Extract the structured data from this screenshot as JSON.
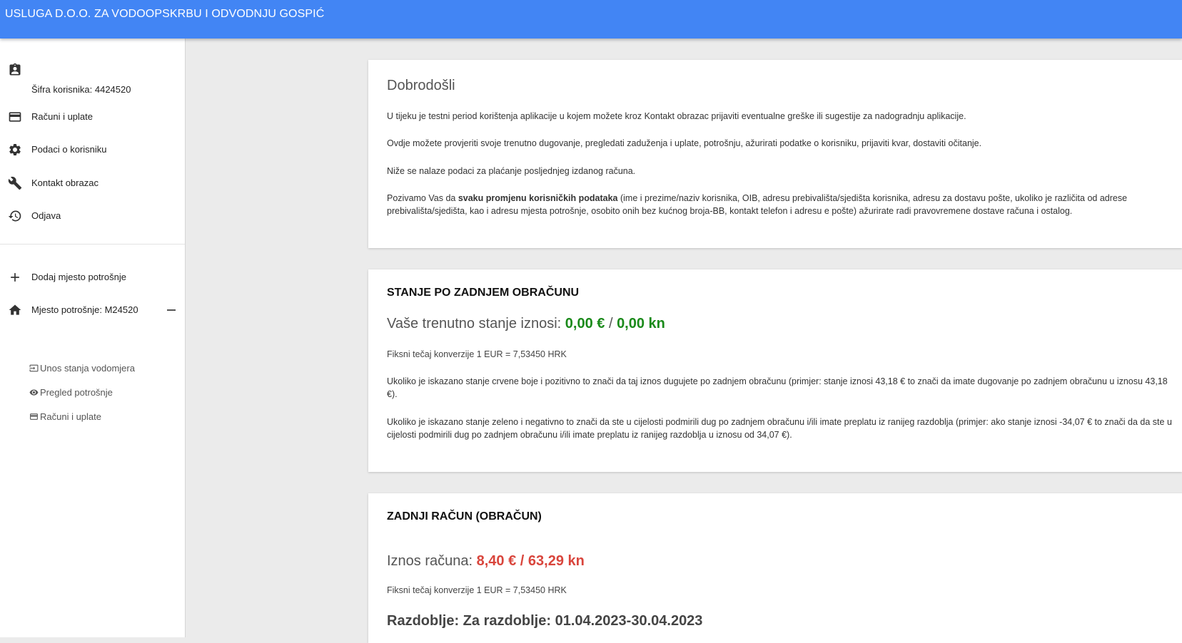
{
  "header": {
    "title": "USLUGA D.O.O. ZA VODOOPSKRBU I ODVODNJU GOSPIĆ"
  },
  "sidebar": {
    "user_label": "Šifra korisnika: 4424520",
    "items": [
      {
        "label": "Računi i uplate",
        "icon": "credit-card-icon"
      },
      {
        "label": "Podaci o korisniku",
        "icon": "gear-icon"
      },
      {
        "label": "Kontakt obrazac",
        "icon": "wrench-icon"
      },
      {
        "label": "Odjava",
        "icon": "history-icon"
      }
    ],
    "add_place_label": "Dodaj mjesto potrošnje",
    "place_label": "Mjesto potrošnje: M24520",
    "sub_items": [
      {
        "label": "Unos stanja vodomjera",
        "icon": "input-icon"
      },
      {
        "label": "Pregled potrošnje",
        "icon": "eye-icon"
      },
      {
        "label": "Računi i uplate",
        "icon": "credit-card-icon"
      }
    ]
  },
  "welcome": {
    "title": "Dobrodošli",
    "p1": "U tijeku je testni period korištenja aplikacije u kojem možete kroz Kontakt obrazac prijaviti eventualne greške ili sugestije za nadogradnju aplikacije.",
    "p2": "Ovdje možete provjeriti svoje trenutno dugovanje, pregledati zaduženja i uplate, potrošnju, ažurirati podatke o korisniku, prijaviti kvar, dostaviti očitanje.",
    "p3": "Niže se nalaze podaci za plaćanje posljednjeg izdanog računa.",
    "p4_prefix": "Pozivamo Vas da ",
    "p4_bold": "svaku promjenu korisničkih podataka",
    "p4_rest": " (ime i prezime/naziv korisnika, OIB, adresu prebivališta/sjedišta korisnika, adresu za dostavu pošte, ukoliko je različita od adrese prebivališta/sjedišta, kao i adresu mjesta potrošnje, osobito onih bez kućnog broja-BB, kontakt telefon i adresu e pošte) ažurirate radi pravovremene dostave računa i ostalog."
  },
  "balance": {
    "title": "STANJE PO ZADNJEM OBRAČUNU",
    "label": "Vaše trenutno stanje iznosi: ",
    "eur": "0,00 €",
    "sep": " / ",
    "kn": "0,00 kn",
    "rate": "Fiksni tečaj konverzije 1 EUR = 7,53450 HRK",
    "p_red": "Ukoliko je iskazano stanje crvene boje i pozitivno to znači da taj iznos dugujete po zadnjem obračunu (primjer: stanje iznosi 43,18 € to znači da imate dugovanje po zadnjem obračunu u iznosu 43,18 €).",
    "p_green": "Ukoliko je iskazano stanje zeleno i negativno to znači da ste u cijelosti podmirili dug po zadnjem obračunu i/ili imate preplatu iz ranijeg razdoblja (primjer: ako stanje iznosi -34,07 € to znači da da ste u cijelosti podmirili dug po zadnjem obračunu i/ili imate preplatu iz ranijeg razdoblja u iznosu od 34,07 €)."
  },
  "last_bill": {
    "title": "ZADNJI RAČUN (OBRAČUN)",
    "label": "Iznos računa: ",
    "amount": "8,40 € / 63,29 kn",
    "rate": "Fiksni tečaj konverzije 1 EUR = 7,53450 HRK",
    "period": "Razdoblje: Za razdoblje: 01.04.2023-30.04.2023"
  },
  "colors": {
    "header_bg": "#4285f4",
    "positive_green": "#1a8a1a",
    "amount_red": "#d9453c"
  }
}
